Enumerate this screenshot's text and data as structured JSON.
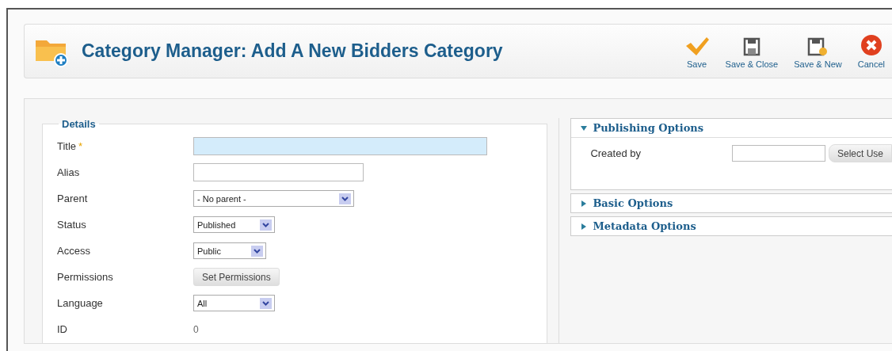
{
  "header": {
    "title": "Category Manager: Add A New Bidders Category"
  },
  "toolbar": [
    {
      "kind": "save",
      "label": "Save"
    },
    {
      "kind": "save-close",
      "label": "Save & Close"
    },
    {
      "kind": "save-new",
      "label": "Save & New"
    },
    {
      "kind": "cancel",
      "label": "Cancel"
    }
  ],
  "details": {
    "legend": "Details",
    "fields": [
      {
        "label": "Title",
        "required_mark": "*",
        "kind": "text",
        "focused": true
      },
      {
        "label": "Alias",
        "kind": "text",
        "focused": false
      },
      {
        "label": "Parent",
        "kind": "select",
        "value": "- No parent -"
      },
      {
        "label": "Status",
        "kind": "select",
        "value": "Published"
      },
      {
        "label": "Access",
        "kind": "select",
        "value": "Public"
      },
      {
        "label": "Permissions",
        "kind": "button",
        "value": "Set Permissions"
      },
      {
        "label": "Language",
        "kind": "select",
        "value": "All"
      },
      {
        "label": "ID",
        "kind": "readonly",
        "value": "0"
      }
    ]
  },
  "panels": [
    {
      "title": "Publishing Options",
      "expanded": true,
      "fields": [
        {
          "label": "Created by",
          "button": "Select Use"
        }
      ]
    },
    {
      "title": "Basic Options",
      "expanded": false
    },
    {
      "title": "Metadata Options",
      "expanded": false
    }
  ]
}
